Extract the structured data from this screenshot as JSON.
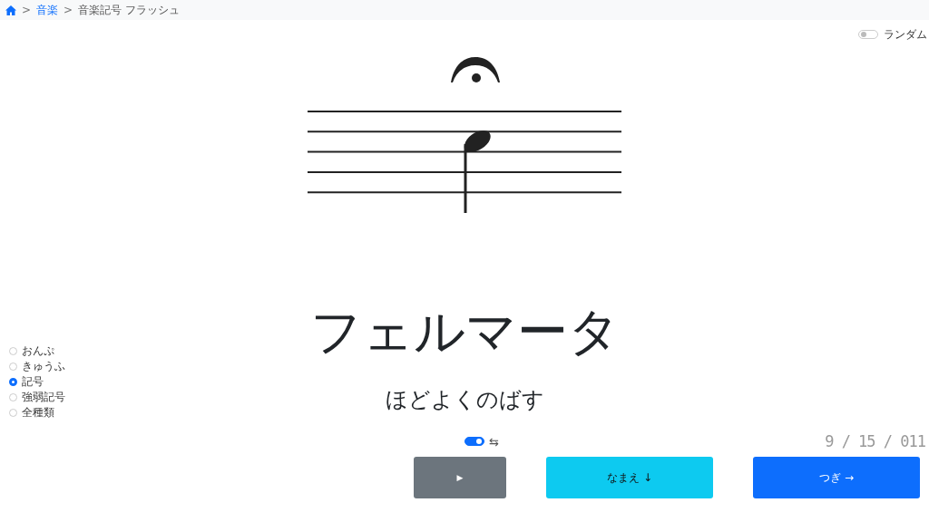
{
  "breadcrumb": [
    {
      "label": "音楽",
      "kind": "link",
      "separator": ">"
    },
    {
      "label": "音楽記号 フラッシュ",
      "kind": "current",
      "separator": ">"
    }
  ],
  "random_toggle": {
    "label": "ランダム",
    "on": false
  },
  "card": {
    "name": "フェルマータ",
    "reading": "ほどよくのばす"
  },
  "categories": [
    {
      "label": "おんぷ",
      "selected": false
    },
    {
      "label": "きゅうふ",
      "selected": false
    },
    {
      "label": "記号",
      "selected": true
    },
    {
      "label": "強弱記号",
      "selected": false
    },
    {
      "label": "全種類",
      "selected": false
    }
  ],
  "swap_toggle": {
    "on": true,
    "icon": "⇆"
  },
  "counter": "9 / 15 / 011",
  "buttons": [
    {
      "label": "▶",
      "kind": "play"
    },
    {
      "label": "なまえ ↓",
      "kind": "reveal"
    },
    {
      "label": "つぎ →",
      "kind": "next"
    }
  ]
}
